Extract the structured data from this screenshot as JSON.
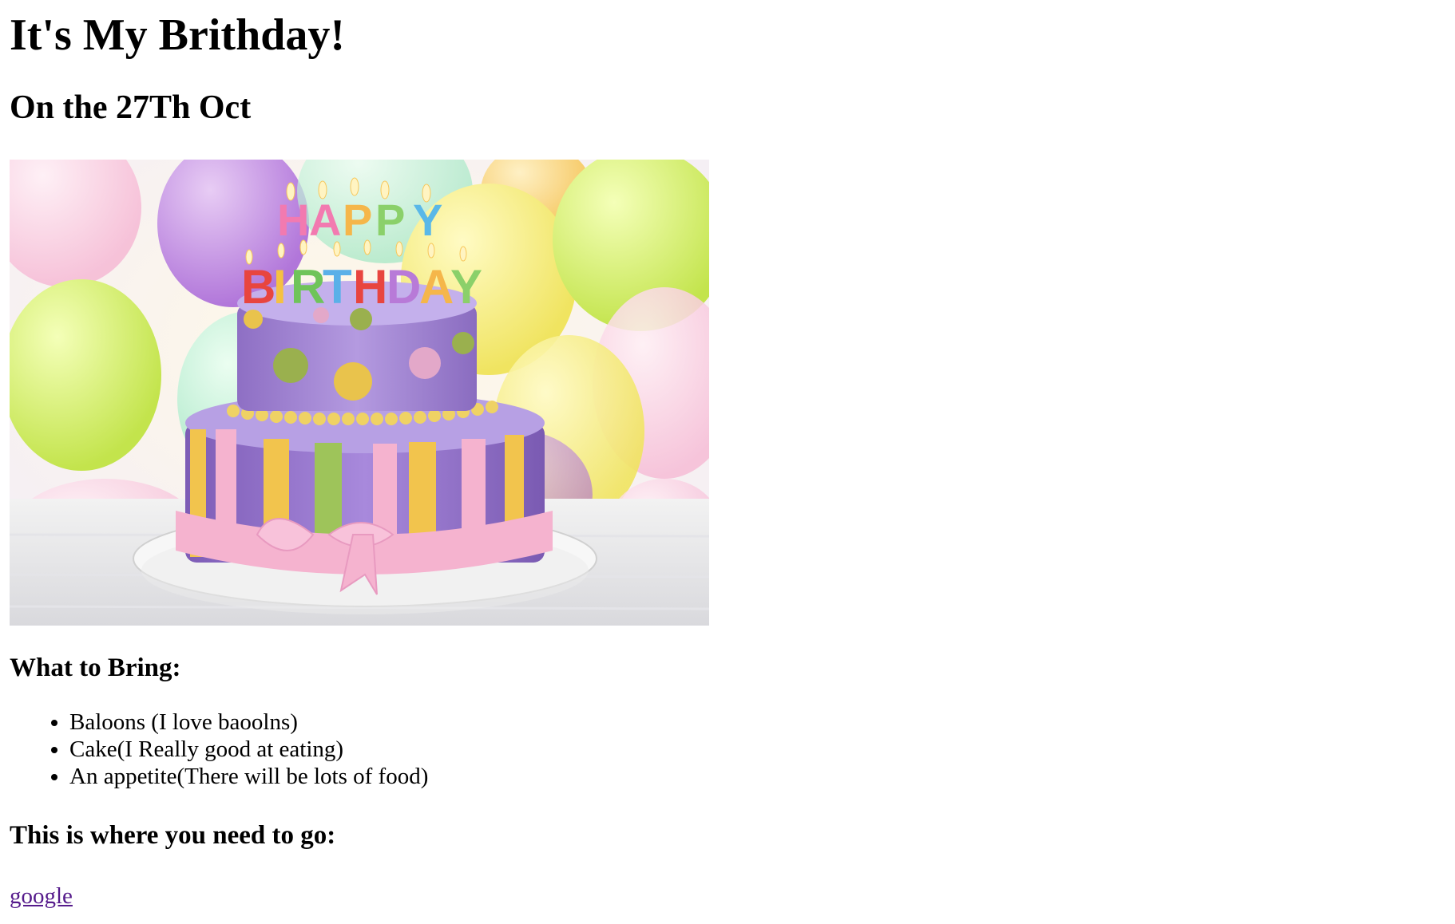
{
  "heading": "It's My Brithday!",
  "date_heading": "On the 27Th Oct",
  "image": {
    "subject": "two-tier birthday cake with HAPPY BIRTHDAY candles in front of colourful balloons",
    "candle_text_top": "HAPPY",
    "candle_text_bottom": "BIRTHDAY"
  },
  "bring_heading": "What to Bring:",
  "bring_items": [
    "Baloons (I love baoolns)",
    "Cake(I Really good at eating)",
    "An appetite(There will be lots of food)"
  ],
  "where_heading": "This is where you need to go:",
  "link": {
    "label": "google",
    "color": "#551a8b"
  }
}
